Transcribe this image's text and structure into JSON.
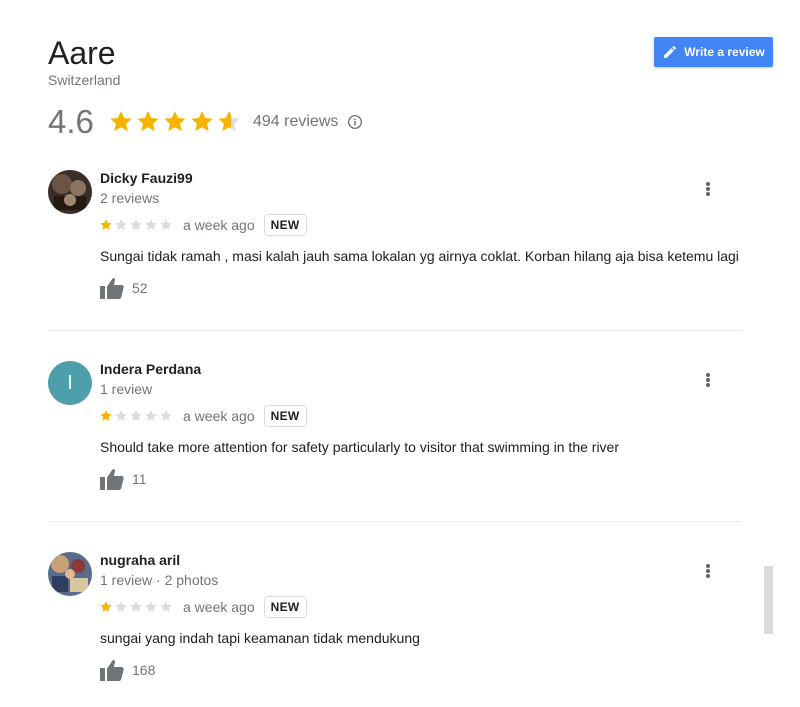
{
  "place": {
    "title": "Aare",
    "subtitle": "Switzerland"
  },
  "write_button": {
    "label": "Write a review",
    "icon": "pencil-icon"
  },
  "summary": {
    "rating": "4.6",
    "rating_value": 4.6,
    "count_label": "494 reviews",
    "info_icon": "info-icon"
  },
  "colors": {
    "star_filled": "#f4b400",
    "star_empty": "#dadce0",
    "accent": "#4285f4",
    "avatar_letter_bg": "#4d9fab"
  },
  "reviews": [
    {
      "author": "Dicky Fauzi99",
      "meta": "2 reviews",
      "rating": 1,
      "time": "a week ago",
      "badge": "NEW",
      "text": "Sungai tidak ramah , masi kalah jauh sama lokalan yg airnya coklat. Korban hilang aja bisa ketemu lagi",
      "likes": "52",
      "avatar": "photo"
    },
    {
      "author": "Indera Perdana",
      "meta": "1 review",
      "rating": 1,
      "time": "a week ago",
      "badge": "NEW",
      "text": "Should take more attention for safety particularly to visitor that swimming in the river",
      "likes": "11",
      "avatar_letter": "I"
    },
    {
      "author": "nugraha aril",
      "meta": "1 review · 2 photos",
      "rating": 1,
      "time": "a week ago",
      "badge": "NEW",
      "text": "sungai yang indah tapi keamanan tidak mendukung",
      "likes": "168",
      "avatar": "photo"
    }
  ]
}
